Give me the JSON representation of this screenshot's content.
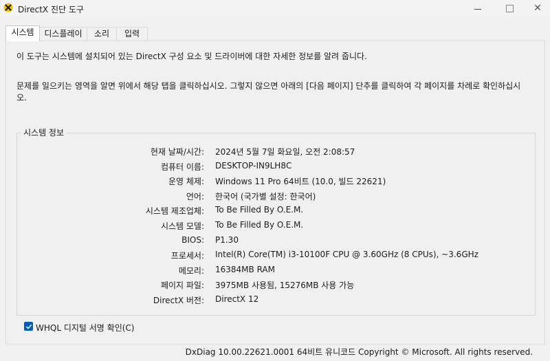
{
  "window": {
    "title": "DirectX 진단 도구",
    "minimize_icon": "minimize-icon",
    "maximize_icon": "maximize-icon",
    "close_glyph": "✕"
  },
  "tabs": [
    {
      "label": "시스템",
      "active": true
    },
    {
      "label": "디스플레이",
      "active": false
    },
    {
      "label": "소리",
      "active": false
    },
    {
      "label": "입력",
      "active": false
    }
  ],
  "intro": {
    "line1": "이 도구는 시스템에 설치되어 있는 DirectX 구성 요소 및 드라이버에 대한 자세한 정보를 알려 줍니다.",
    "line2": "문제를 일으키는 영역을 알면 위에서 해당 탭을 클릭하십시오. 그렇지 않으면 아래의 [다음 페이지] 단추를 클릭하여 각 페이지를 차례로 확인하십시오."
  },
  "system_info": {
    "group_title": "시스템 정보",
    "rows": [
      {
        "label": "현재 날짜/시간:",
        "value": "2024년 5월 7일 화요일, 오전 2:08:57"
      },
      {
        "label": "컴퓨터 이름:",
        "value": "DESKTOP-IN9LH8C"
      },
      {
        "label": "운영 체제:",
        "value": "Windows 11 Pro 64비트 (10.0, 빌드 22621)"
      },
      {
        "label": "언어:",
        "value": "한국어 (국가별 설정: 한국어)"
      },
      {
        "label": "시스템 제조업체:",
        "value": "To Be Filled By O.E.M."
      },
      {
        "label": "시스템 모델:",
        "value": "To Be Filled By O.E.M."
      },
      {
        "label": "BIOS:",
        "value": "P1.30"
      },
      {
        "label": "프로세서:",
        "value": "Intel(R) Core(TM) i3-10100F CPU @ 3.60GHz (8 CPUs), ~3.6GHz"
      },
      {
        "label": "메모리:",
        "value": "16384MB RAM"
      },
      {
        "label": "페이지 파일:",
        "value": "3975MB 사용됨, 15276MB 사용 가능"
      },
      {
        "label": "DirectX 버전:",
        "value": "DirectX 12"
      }
    ]
  },
  "whql": {
    "label": "WHQL 디지털 서명 확인(C)",
    "checked": true
  },
  "footer": {
    "text": "DxDiag 10.00.22621.0001 64비트 유니코드  Copyright © Microsoft. All rights reserved."
  },
  "colors": {
    "accent": "#005fb8",
    "window_bg": "#f0f0f0"
  }
}
